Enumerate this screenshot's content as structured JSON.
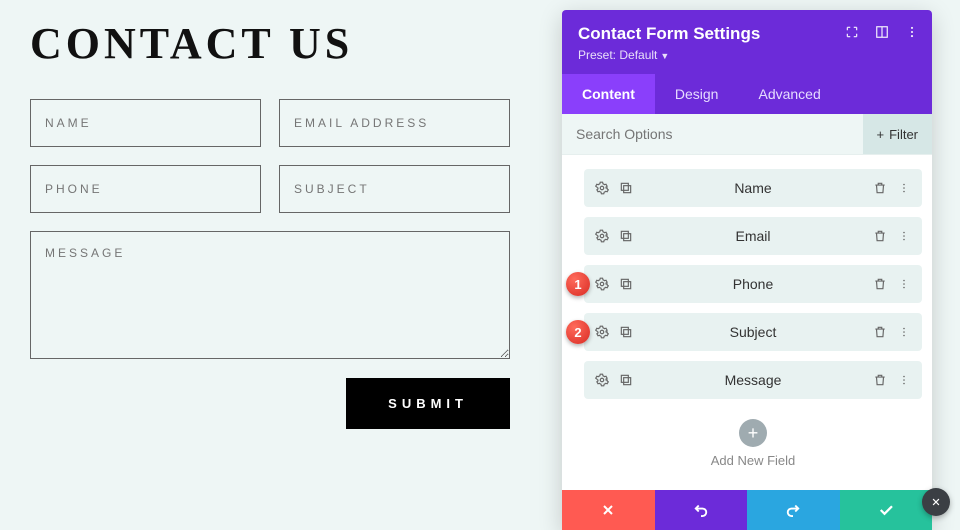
{
  "form": {
    "title": "CONTACT US",
    "placeholders": {
      "name": "NAME",
      "email": "EMAIL ADDRESS",
      "phone": "PHONE",
      "subject": "SUBJECT",
      "message": "MESSAGE"
    },
    "submit_label": "SUBMIT"
  },
  "panel": {
    "title": "Contact Form Settings",
    "preset_label": "Preset: Default",
    "tabs": {
      "content": "Content",
      "design": "Design",
      "advanced": "Advanced"
    },
    "search_placeholder": "Search Options",
    "filter_label": "Filter",
    "fields": [
      {
        "label": "Name"
      },
      {
        "label": "Email"
      },
      {
        "label": "Phone",
        "badge": "1"
      },
      {
        "label": "Subject",
        "badge": "2"
      },
      {
        "label": "Message"
      }
    ],
    "add_label": "Add New Field"
  }
}
